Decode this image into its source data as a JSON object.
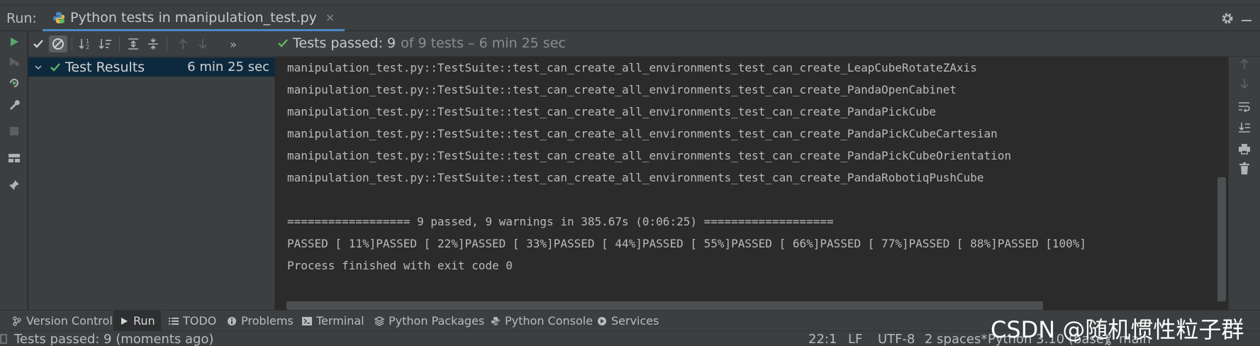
{
  "run_bar": {
    "label": "Run:",
    "tab_title": "Python tests in manipulation_test.py",
    "close_glyph": "×"
  },
  "test_toolbar": {
    "status_ok": "Tests passed: 9",
    "status_rest": "of 9 tests – 6 min 25 sec",
    "more_glyph": "»"
  },
  "tree": {
    "root_label": "Test Results",
    "root_time": "6 min 25 sec"
  },
  "console": {
    "lines": [
      "manipulation_test.py::TestSuite::test_can_create_all_environments_test_can_create_LeapCubeRotateZAxis",
      "manipulation_test.py::TestSuite::test_can_create_all_environments_test_can_create_PandaOpenCabinet",
      "manipulation_test.py::TestSuite::test_can_create_all_environments_test_can_create_PandaPickCube",
      "manipulation_test.py::TestSuite::test_can_create_all_environments_test_can_create_PandaPickCubeCartesian",
      "manipulation_test.py::TestSuite::test_can_create_all_environments_test_can_create_PandaPickCubeOrientation",
      "manipulation_test.py::TestSuite::test_can_create_all_environments_test_can_create_PandaRobotiqPushCube",
      "",
      "================== 9 passed, 9 warnings in 385.67s (0:06:25) ===================",
      "PASSED [ 11%]PASSED [ 22%]PASSED [ 33%]PASSED [ 44%]PASSED [ 55%]PASSED [ 66%]PASSED [ 77%]PASSED [ 88%]PASSED [100%]",
      "Process finished with exit code 0"
    ]
  },
  "tool_windows": [
    {
      "label": "Version Control",
      "icon": "branch-icon"
    },
    {
      "label": "Run",
      "icon": "play-icon"
    },
    {
      "label": "TODO",
      "icon": "list-icon"
    },
    {
      "label": "Problems",
      "icon": "info-icon"
    },
    {
      "label": "Terminal",
      "icon": "terminal-icon"
    },
    {
      "label": "Python Packages",
      "icon": "layers-icon"
    },
    {
      "label": "Python Console",
      "icon": "python-icon"
    },
    {
      "label": "Services",
      "icon": "services-icon"
    }
  ],
  "status_bar": {
    "message": "Tests passed: 9 (moments ago)",
    "position": "22:1",
    "line_sep": "LF",
    "encoding": "UTF-8",
    "indent": "2 spaces*",
    "interpreter": "Python 3.10 (base)",
    "branch": "main"
  },
  "watermark": "CSDN @随机惯性粒子群",
  "colors": {
    "pass_green": "#5fb85f",
    "run_green": "#59a869",
    "accent_blue": "#4a88c7"
  }
}
